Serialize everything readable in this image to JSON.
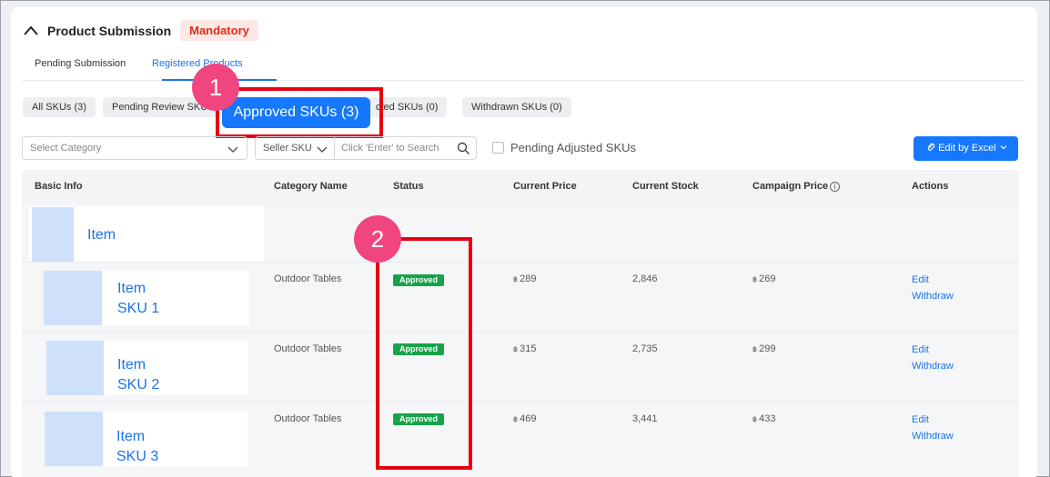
{
  "section": {
    "title": "Product Submission",
    "badge": "Mandatory"
  },
  "tabs": [
    {
      "label": "Pending Submission",
      "active": false
    },
    {
      "label": "Registered Products",
      "active": true
    }
  ],
  "filters": {
    "chips": [
      {
        "label": "All SKUs (3)"
      },
      {
        "label": "Pending Review SKUs"
      },
      {
        "label": "cted SKUs (0)"
      },
      {
        "label": "Withdrawn SKUs (0)"
      }
    ],
    "approved_chip": "Approved SKUs (3)"
  },
  "callouts": [
    "1",
    "2"
  ],
  "toolbar": {
    "category_placeholder": "Select Category",
    "search_field": "Seller SKU",
    "search_placeholder": "Click 'Enter' to Search",
    "pending_adjusted": "Pending Adjusted SKUs",
    "edit_by_excel": "Edit by Excel"
  },
  "table": {
    "columns": [
      "Basic Info",
      "Category Name",
      "Status",
      "Current Price",
      "Current Stock",
      "Campaign Price",
      "Actions"
    ],
    "parent_item": "Item",
    "rows": [
      {
        "name_line1": "Item",
        "name_line2": "SKU 1",
        "category": "Outdoor Tables",
        "status": "Approved",
        "currency": "฿",
        "price": "289",
        "stock": "2,846",
        "campaign_price": "269",
        "action_edit": "Edit",
        "action_withdraw": "Withdraw"
      },
      {
        "name_line1": "Item",
        "name_line2": "SKU 2",
        "category": "Outdoor Tables",
        "status": "Approved",
        "currency": "฿",
        "price": "315",
        "stock": "2,735",
        "campaign_price": "299",
        "action_edit": "Edit",
        "action_withdraw": "Withdraw"
      },
      {
        "name_line1": "Item",
        "name_line2": "SKU 3",
        "category": "Outdoor Tables",
        "status": "Approved",
        "currency": "฿",
        "price": "469",
        "stock": "3,441",
        "campaign_price": "433",
        "action_edit": "Edit",
        "action_withdraw": "Withdraw"
      }
    ]
  },
  "colors": {
    "accent": "#1677ff",
    "approved": "#17a34a",
    "mandatory": "#e02d1b",
    "highlight": "#e60012",
    "callout": "#f0457f"
  }
}
